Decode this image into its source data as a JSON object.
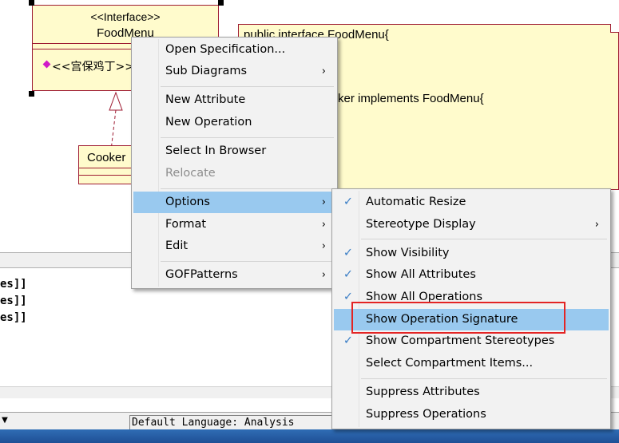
{
  "canvas": {
    "interface_class": {
      "stereotype": "<<Interface>>",
      "name": "FoodMenu",
      "operation": "<<宫保鸡丁>>"
    },
    "cooker_class": {
      "name": "Cooker"
    },
    "note": {
      "line1": "public interface FoodMenu{",
      "line2": "ker implements FoodMenu{"
    }
  },
  "log_panel": {
    "lines": [
      "es]]",
      "es]]",
      "es]]"
    ]
  },
  "statusbar": {
    "default_language": "Default Language: Analysis"
  },
  "context_menu": {
    "items": [
      {
        "label": "Open Specification...",
        "submenu": false,
        "enabled": true
      },
      {
        "label": "Sub Diagrams",
        "submenu": true,
        "enabled": true
      },
      {
        "label": "New Attribute",
        "submenu": false,
        "enabled": true
      },
      {
        "label": "New Operation",
        "submenu": false,
        "enabled": true
      },
      {
        "label": "Select In Browser",
        "submenu": false,
        "enabled": true
      },
      {
        "label": "Relocate",
        "submenu": false,
        "enabled": false
      },
      {
        "label": "Options",
        "submenu": true,
        "enabled": true,
        "highlighted": true
      },
      {
        "label": "Format",
        "submenu": true,
        "enabled": true
      },
      {
        "label": "Edit",
        "submenu": true,
        "enabled": true
      },
      {
        "label": "GOFPatterns",
        "submenu": true,
        "enabled": true
      }
    ],
    "arrow_glyph": "›"
  },
  "options_submenu": {
    "items": [
      {
        "label": "Automatic Resize",
        "checked": true
      },
      {
        "label": "Stereotype Display",
        "submenu": true
      },
      {
        "label": "Show Visibility",
        "checked": true
      },
      {
        "label": "Show All Attributes",
        "checked": true
      },
      {
        "label": "Show All Operations",
        "checked": true
      },
      {
        "label": "Show Operation Signature",
        "checked": false,
        "highlighted": true
      },
      {
        "label": "Show Compartment Stereotypes",
        "checked": true
      },
      {
        "label": "Select Compartment Items...",
        "checked": false
      },
      {
        "label": "Suppress Attributes",
        "checked": false
      },
      {
        "label": "Suppress Operations",
        "checked": false
      }
    ],
    "check_glyph": "✓",
    "arrow_glyph": "›"
  },
  "colors": {
    "menu_highlight": "#99c9ef",
    "class_fill": "#fffbcc",
    "class_border": "#9e1b32",
    "annotation_box": "#e32424"
  }
}
